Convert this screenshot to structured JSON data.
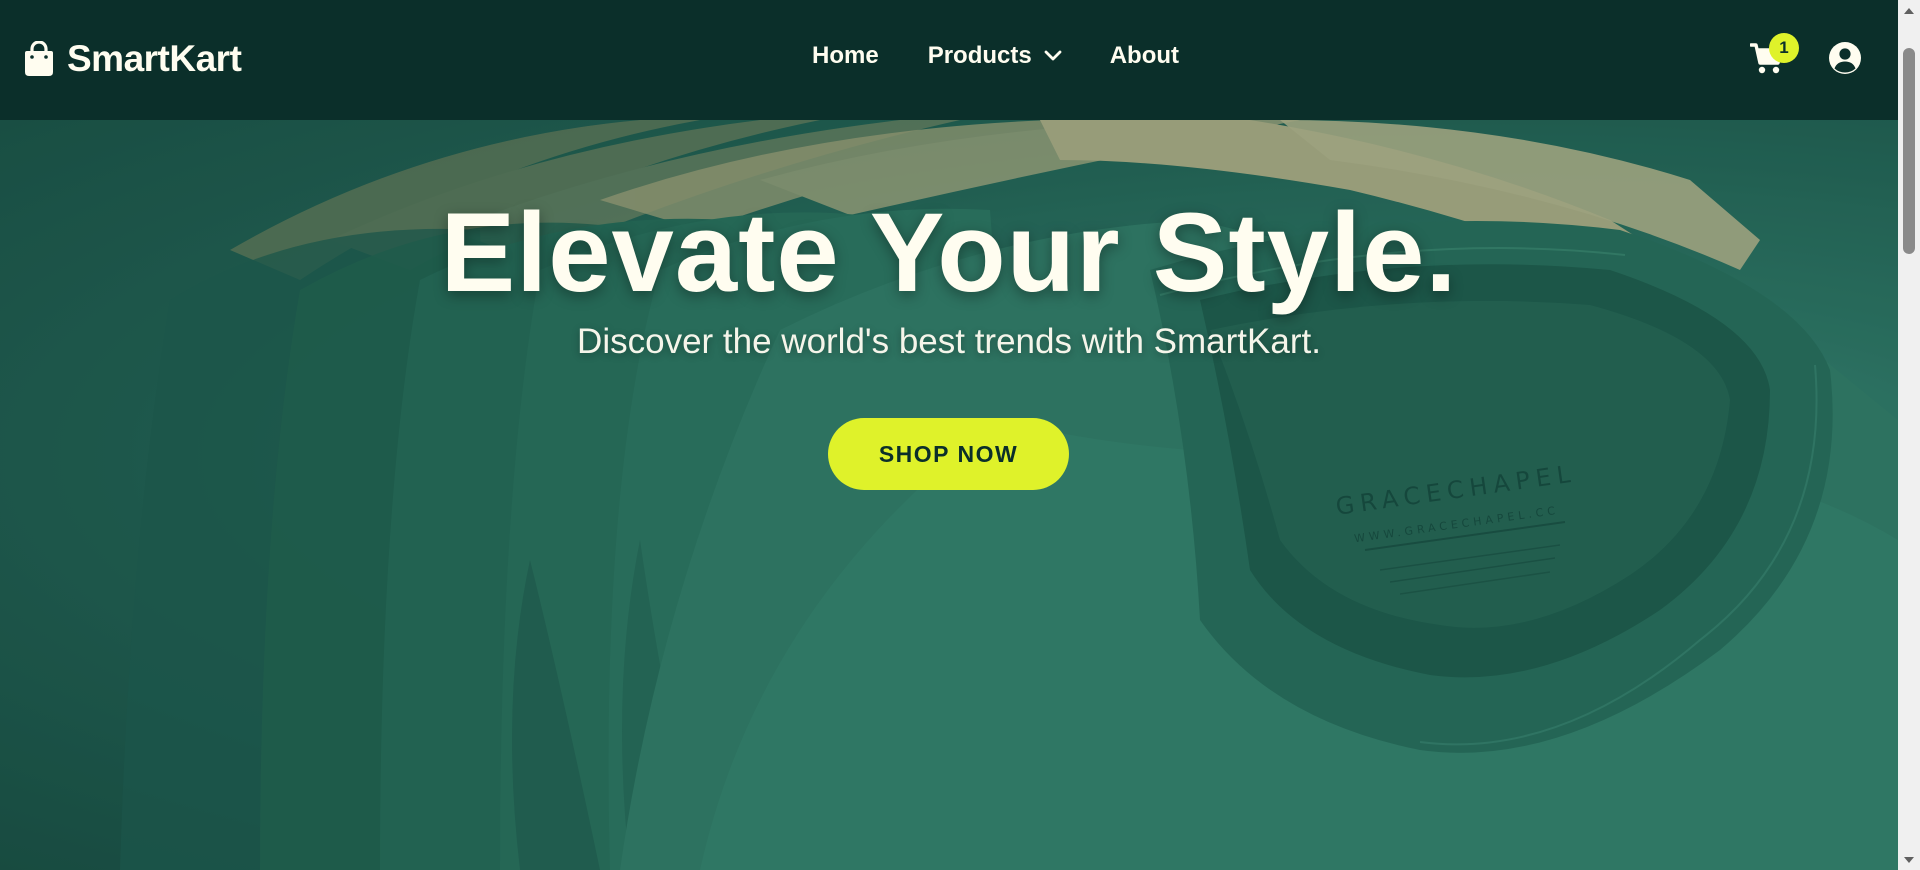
{
  "brand": {
    "name": "SmartKart",
    "icon": "shopping-bag-icon"
  },
  "nav": {
    "items": [
      {
        "label": "Home"
      },
      {
        "label": "Products",
        "icon": "chevron-down-icon"
      },
      {
        "label": "About"
      }
    ]
  },
  "header_actions": {
    "cart_icon": "shopping-cart-icon",
    "cart_count": "1",
    "user_icon": "user-circle-icon"
  },
  "hero": {
    "title": "Elevate Your Style.",
    "subtitle": "Discover the world's best trends with SmartKart.",
    "cta_label": "SHOP NOW",
    "tag_brand": "GRACECHAPEL",
    "tag_url": "WWW.GRACECHAPEL.CC"
  },
  "colors": {
    "nav_background": "#0b2f2a",
    "accent": "#dff22a",
    "text_light": "#fffdf0",
    "hero_green": "#2e7463"
  }
}
